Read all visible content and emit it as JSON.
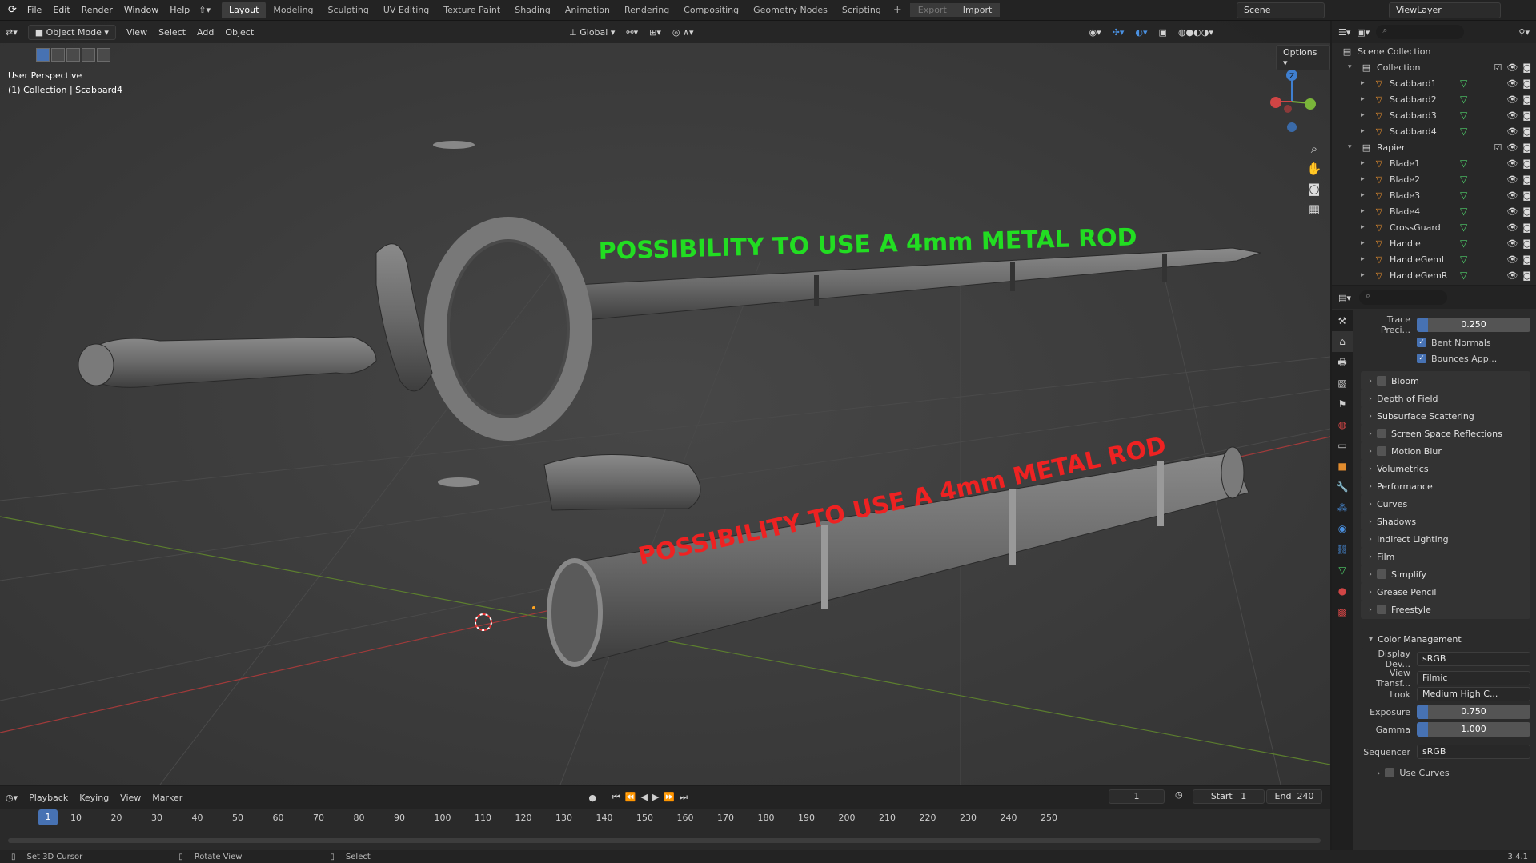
{
  "menu": {
    "items": [
      "File",
      "Edit",
      "Render",
      "Window",
      "Help"
    ]
  },
  "workspaces": [
    "Layout",
    "Modeling",
    "Sculpting",
    "UV Editing",
    "Texture Paint",
    "Shading",
    "Animation",
    "Rendering",
    "Compositing",
    "Geometry Nodes",
    "Scripting"
  ],
  "export_label": "Export",
  "import_label": "Import",
  "scene_name": "Scene",
  "view_layer": "ViewLayer",
  "viewport": {
    "mode": "Object Mode",
    "menus": [
      "View",
      "Select",
      "Add",
      "Object"
    ],
    "transform": "Global",
    "options_label": "Options",
    "perspective_label": "User Perspective",
    "collection_label": "(1) Collection | Scabbard4",
    "annotation_top": "POSSIBILITY TO USE A 4mm METAL ROD",
    "annotation_bottom": "POSSIBILITY TO USE A 4mm METAL ROD",
    "annotation_top_color": "#22dd22",
    "annotation_bottom_color": "#ee2222"
  },
  "outliner": {
    "root": "Scene Collection",
    "rows": [
      {
        "label": "Collection",
        "type": "collection",
        "depth": 0
      },
      {
        "label": "Scabbard1",
        "type": "mesh",
        "depth": 1
      },
      {
        "label": "Scabbard2",
        "type": "mesh",
        "depth": 1
      },
      {
        "label": "Scabbard3",
        "type": "mesh",
        "depth": 1
      },
      {
        "label": "Scabbard4",
        "type": "mesh",
        "depth": 1
      },
      {
        "label": "Rapier",
        "type": "collection",
        "depth": 0
      },
      {
        "label": "Blade1",
        "type": "mesh",
        "depth": 1
      },
      {
        "label": "Blade2",
        "type": "mesh",
        "depth": 1
      },
      {
        "label": "Blade3",
        "type": "mesh",
        "depth": 1
      },
      {
        "label": "Blade4",
        "type": "mesh",
        "depth": 1
      },
      {
        "label": "CrossGuard",
        "type": "mesh",
        "depth": 1
      },
      {
        "label": "Handle",
        "type": "mesh",
        "depth": 1
      },
      {
        "label": "HandleGemL",
        "type": "mesh",
        "depth": 1
      },
      {
        "label": "HandleGemR",
        "type": "mesh",
        "depth": 1
      }
    ]
  },
  "properties": {
    "trace_label": "Trace Preci...",
    "trace_value": "0.250",
    "bent_normals": "Bent Normals",
    "bounces": "Bounces App...",
    "panels": [
      {
        "label": "Bloom",
        "cb": true
      },
      {
        "label": "Depth of Field",
        "cb": false
      },
      {
        "label": "Subsurface Scattering",
        "cb": false
      },
      {
        "label": "Screen Space Reflections",
        "cb": true
      },
      {
        "label": "Motion Blur",
        "cb": true
      },
      {
        "label": "Volumetrics",
        "cb": false
      },
      {
        "label": "Performance",
        "cb": false
      },
      {
        "label": "Curves",
        "cb": false
      },
      {
        "label": "Shadows",
        "cb": false
      },
      {
        "label": "Indirect Lighting",
        "cb": false
      },
      {
        "label": "Film",
        "cb": false
      },
      {
        "label": "Simplify",
        "cb": true
      },
      {
        "label": "Grease Pencil",
        "cb": false
      },
      {
        "label": "Freestyle",
        "cb": true
      }
    ],
    "color_mgmt": "Color Management",
    "display_label": "Display Dev...",
    "display_value": "sRGB",
    "view_label": "View Transf...",
    "view_value": "Filmic",
    "look_label": "Look",
    "look_value": "Medium High C...",
    "exposure_label": "Exposure",
    "exposure_value": "0.750",
    "gamma_label": "Gamma",
    "gamma_value": "1.000",
    "sequencer_label": "Sequencer",
    "sequencer_value": "sRGB",
    "use_curves": "Use Curves"
  },
  "timeline": {
    "menus": [
      "Playback",
      "Keying",
      "View",
      "Marker"
    ],
    "current_frame": "1",
    "start_label": "Start",
    "start": "1",
    "end_label": "End",
    "end": "240",
    "ticks": [
      "10",
      "20",
      "30",
      "40",
      "50",
      "60",
      "70",
      "80",
      "90",
      "100",
      "110",
      "120",
      "130",
      "140",
      "150",
      "160",
      "170",
      "180",
      "190",
      "200",
      "210",
      "220",
      "230",
      "240",
      "250"
    ]
  },
  "status": {
    "left": "Set 3D Cursor",
    "mid": "Rotate View",
    "right": "Select",
    "version": "3.4.1"
  }
}
